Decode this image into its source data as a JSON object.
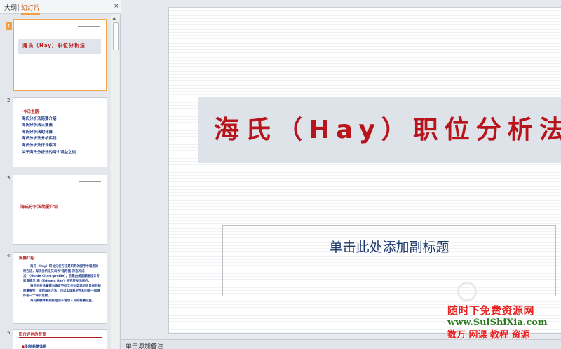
{
  "left_pane": {
    "tabs": [
      {
        "label": "大纲"
      },
      {
        "label": "幻灯片"
      }
    ],
    "close_glyph": "×"
  },
  "thumbnails": [
    {
      "number": "1",
      "title": "海氏（Hay）职位分析法"
    },
    {
      "number": "2",
      "heading": "·今日主题·",
      "items": [
        "海氏分析法简要介绍",
        "海氏分析法三要素",
        "海氏分析法的计算",
        "海氏分析法分析实践",
        "海氏分析法行业练习",
        "关于海氏分析法的两个误益之谈"
      ]
    },
    {
      "number": "3",
      "title": "海氏分析法简要介绍"
    },
    {
      "number": "4",
      "title": "简要介绍",
      "paragraphs": [
        "海氏（Hay）职位分析方法是职务的排序中常用的一种方法，海氏分析法又叫作\"指导图-形态构成法\"（Guide Chart-profile），它是由美国薪酬设计专家爱德华·海（Edward Hay）研究开发出来的。",
        "海氏分析法掌握与确定不同工作对实现组织目标的能相重要性，借助海氏方法，可以实现科学性和可等一联体作由一个评价总数。",
        "海氏薪酬体系按标组流于管理人员的薪酬设置。"
      ]
    },
    {
      "number": "5",
      "title": "职位评估的背景",
      "item": "职能薪酬体系"
    }
  ],
  "slide": {
    "title": "海氏（Hay）职位分析法",
    "subtitle_placeholder": "单击此处添加副标题"
  },
  "notes": {
    "placeholder": "单击添加备注"
  },
  "watermark": {
    "line1": "随时下免费资源网",
    "line2": "www.SuiShiXia.com",
    "line3": "数万 网课 教程 资源"
  },
  "colors": {
    "accent_orange": "#f0a040",
    "title_red": "#b8141b",
    "text_blue": "#1f3b8c"
  }
}
